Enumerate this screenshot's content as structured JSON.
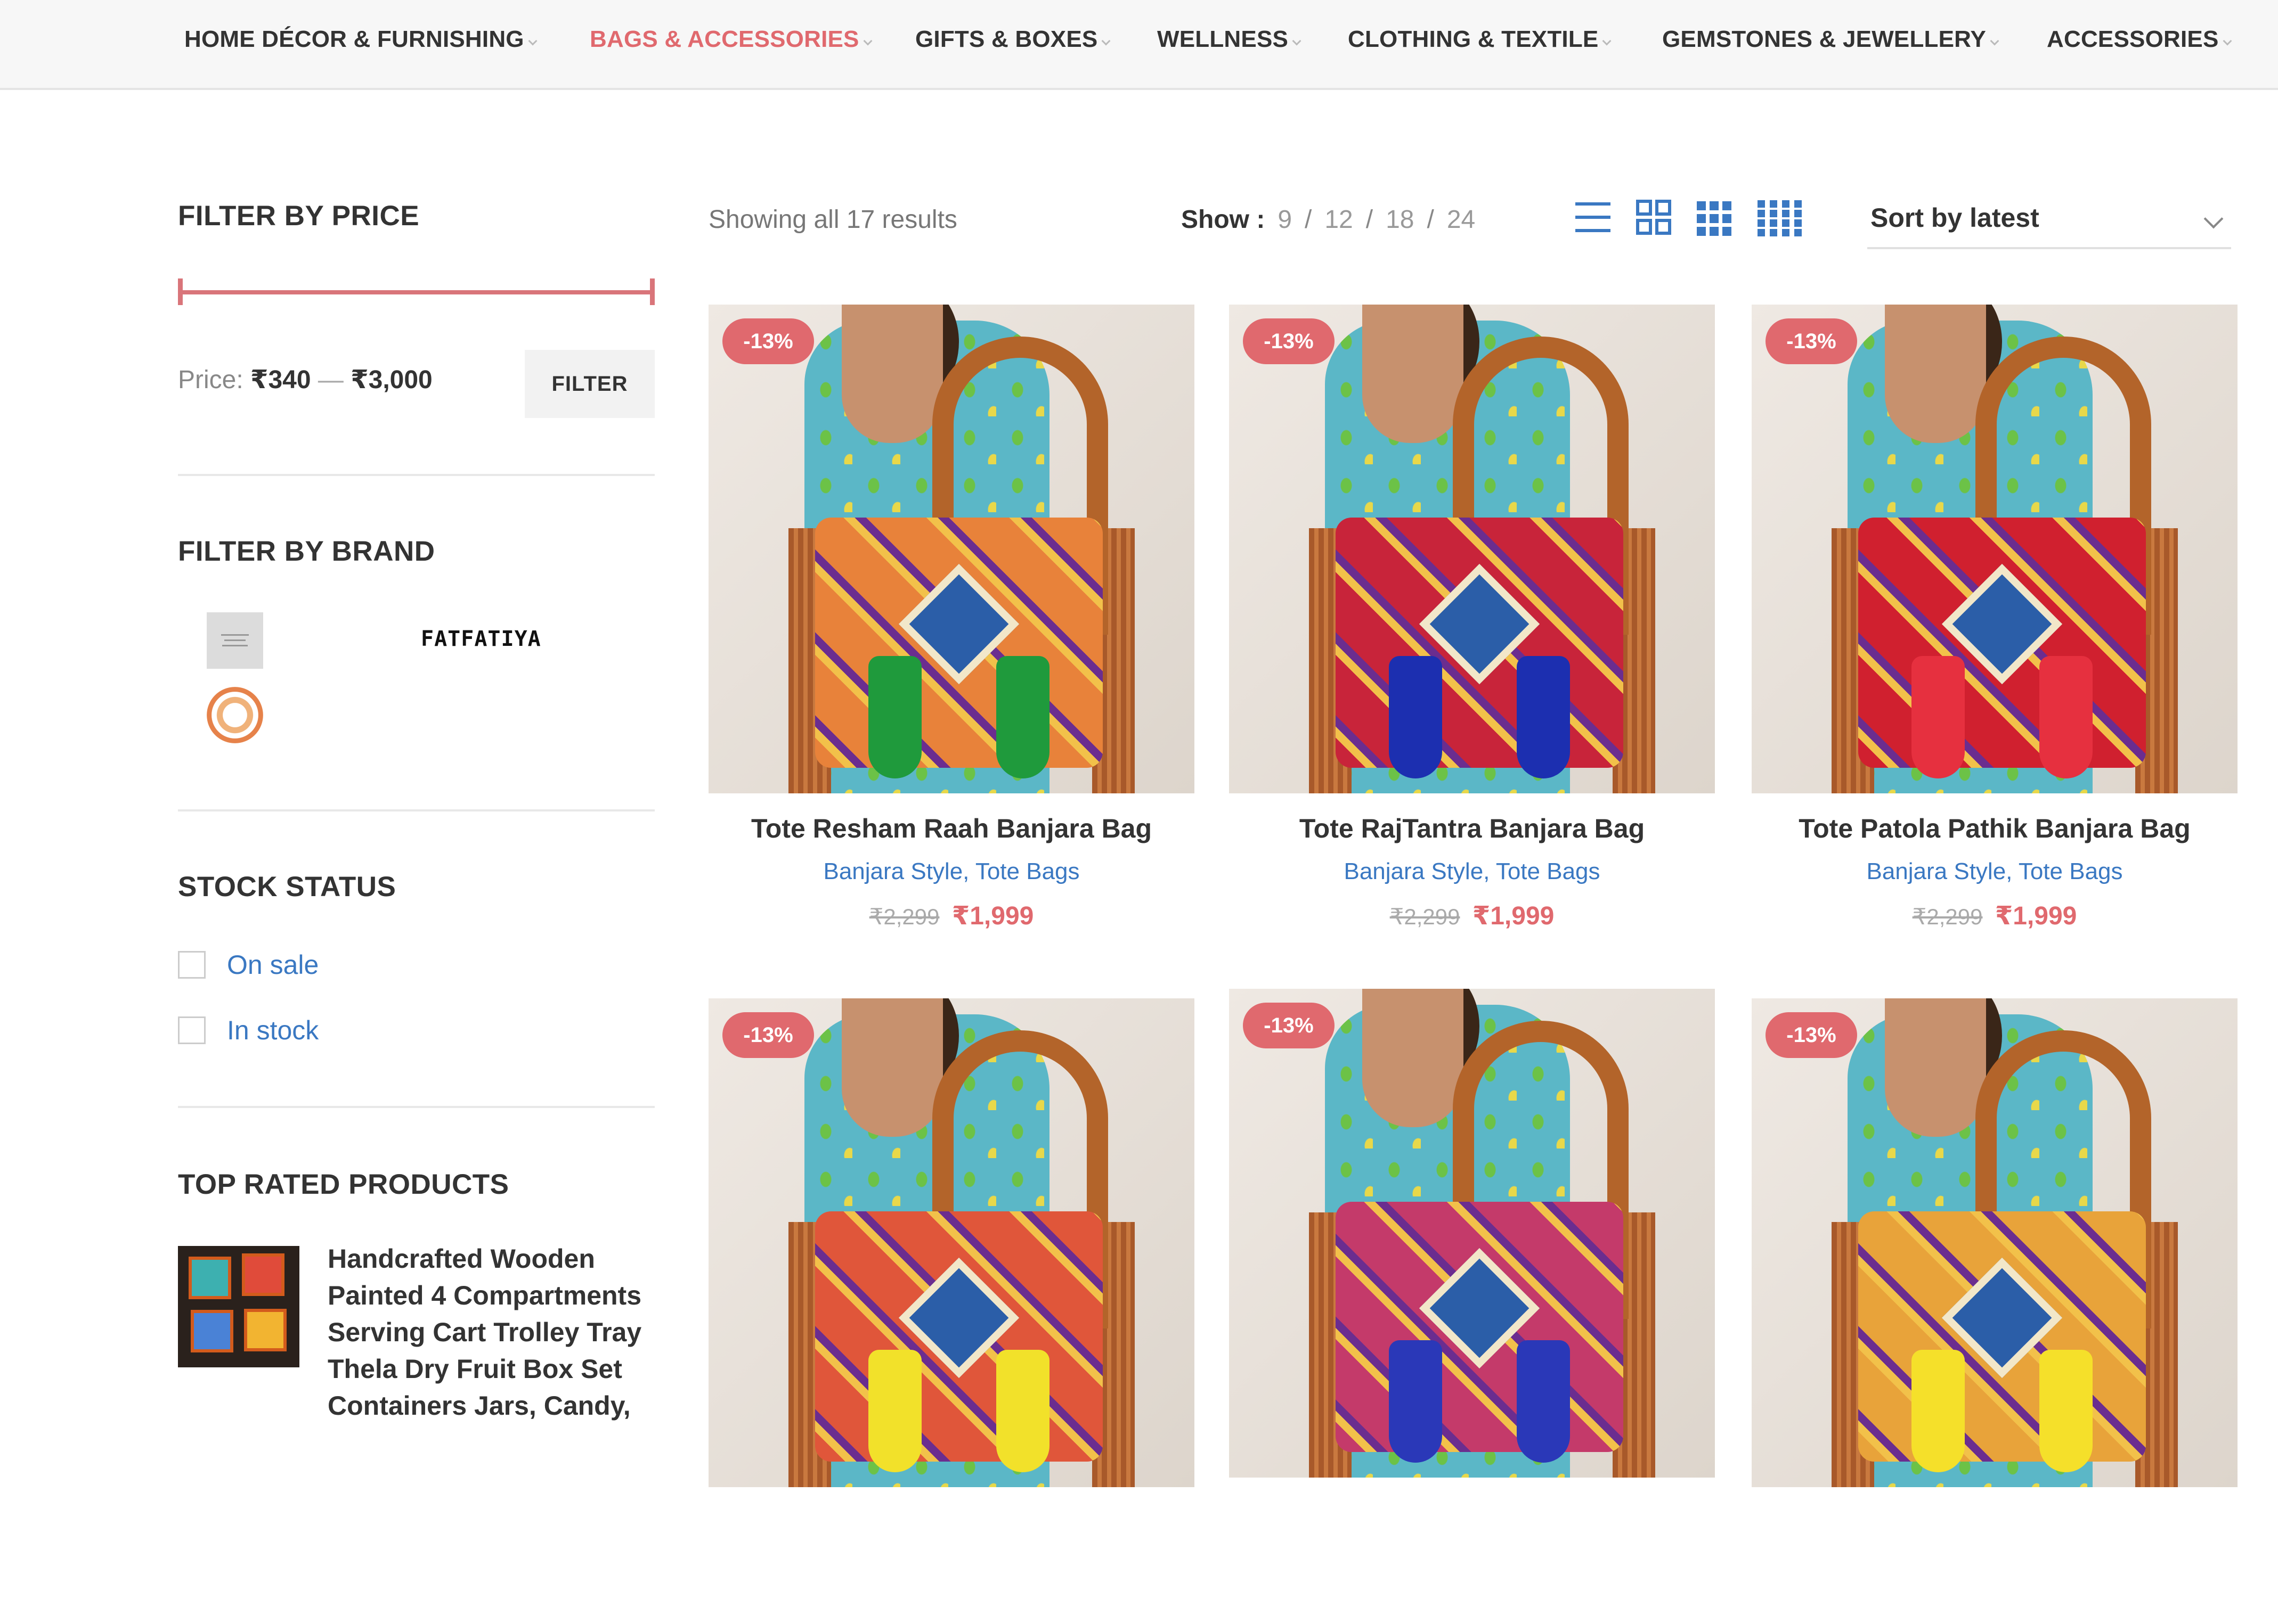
{
  "nav": {
    "items": [
      {
        "label": "HOME DÉCOR & FURNISHING",
        "active": false
      },
      {
        "label": "BAGS & ACCESSORIES",
        "active": true
      },
      {
        "label": "GIFTS & BOXES",
        "active": false
      },
      {
        "label": "WELLNESS",
        "active": false
      },
      {
        "label": "CLOTHING & TEXTILE",
        "active": false
      },
      {
        "label": "GEMSTONES & JEWELLERY",
        "active": false
      },
      {
        "label": "ACCESSORIES",
        "active": false
      }
    ]
  },
  "sidebar": {
    "price_filter": {
      "title": "FILTER BY PRICE",
      "price_prefix": "Price:",
      "min": "₹340",
      "dash": "—",
      "max": "₹3,000",
      "button_label": "FILTER"
    },
    "brand_filter": {
      "title": "FILTER BY BRAND",
      "logos": [
        "brand-logo-grey",
        "FATFATIYA",
        "brand-logo-circle"
      ],
      "text_logo": "FATFATIYA"
    },
    "stock_status": {
      "title": "STOCK STATUS",
      "options": [
        {
          "label": "On sale",
          "checked": false
        },
        {
          "label": "In stock",
          "checked": false
        }
      ]
    },
    "top_rated": {
      "title": "TOP RATED PRODUCTS",
      "items": [
        {
          "title": "Handcrafted Wooden Painted 4 Compartments Serving Cart Trolley Tray Thela Dry Fruit Box Set Containers Jars, Candy,"
        }
      ]
    }
  },
  "toolbar": {
    "results_text": "Showing all 17 results",
    "show_label": "Show :",
    "show_options": [
      "9",
      "12",
      "18",
      "24"
    ],
    "view_icons": [
      "list-view-icon",
      "grid-2-icon",
      "grid-3-icon",
      "grid-4-icon"
    ],
    "sort_label": "Sort by latest"
  },
  "products": [
    {
      "badge": "-13%",
      "title": "Tote Resham Raah Banjara Bag",
      "categories": "Banjara Style, Tote Bags",
      "old_price": "₹2,299",
      "price": "₹1,999",
      "bag_colors": [
        "#e8823a",
        "#1f9a3c"
      ]
    },
    {
      "badge": "-13%",
      "title": "Tote RajTantra Banjara Bag",
      "categories": "Banjara Style, Tote Bags",
      "old_price": "₹2,299",
      "price": "₹1,999",
      "bag_colors": [
        "#c8243a",
        "#1c2fb0"
      ]
    },
    {
      "badge": "-13%",
      "title": "Tote Patola Pathik Banjara Bag",
      "categories": "Banjara Style, Tote Bags",
      "old_price": "₹2,299",
      "price": "₹1,999",
      "bag_colors": [
        "#d0202f",
        "#e6303f"
      ]
    },
    {
      "badge": "-13%",
      "title": "",
      "categories": "",
      "old_price": "",
      "price": "",
      "bag_colors": [
        "#e0563a",
        "#f2e12a"
      ]
    },
    {
      "badge": "-13%",
      "title": "",
      "categories": "",
      "old_price": "",
      "price": "",
      "bag_colors": [
        "#c43a6a",
        "#2a38b8"
      ]
    },
    {
      "badge": "-13%",
      "title": "",
      "categories": "",
      "old_price": "",
      "price": "",
      "bag_colors": [
        "#e8a33a",
        "#f5e02a"
      ]
    }
  ],
  "colors": {
    "accent": "#e0696e",
    "link": "#3a78c2",
    "view_icon": "#3a78c2"
  }
}
